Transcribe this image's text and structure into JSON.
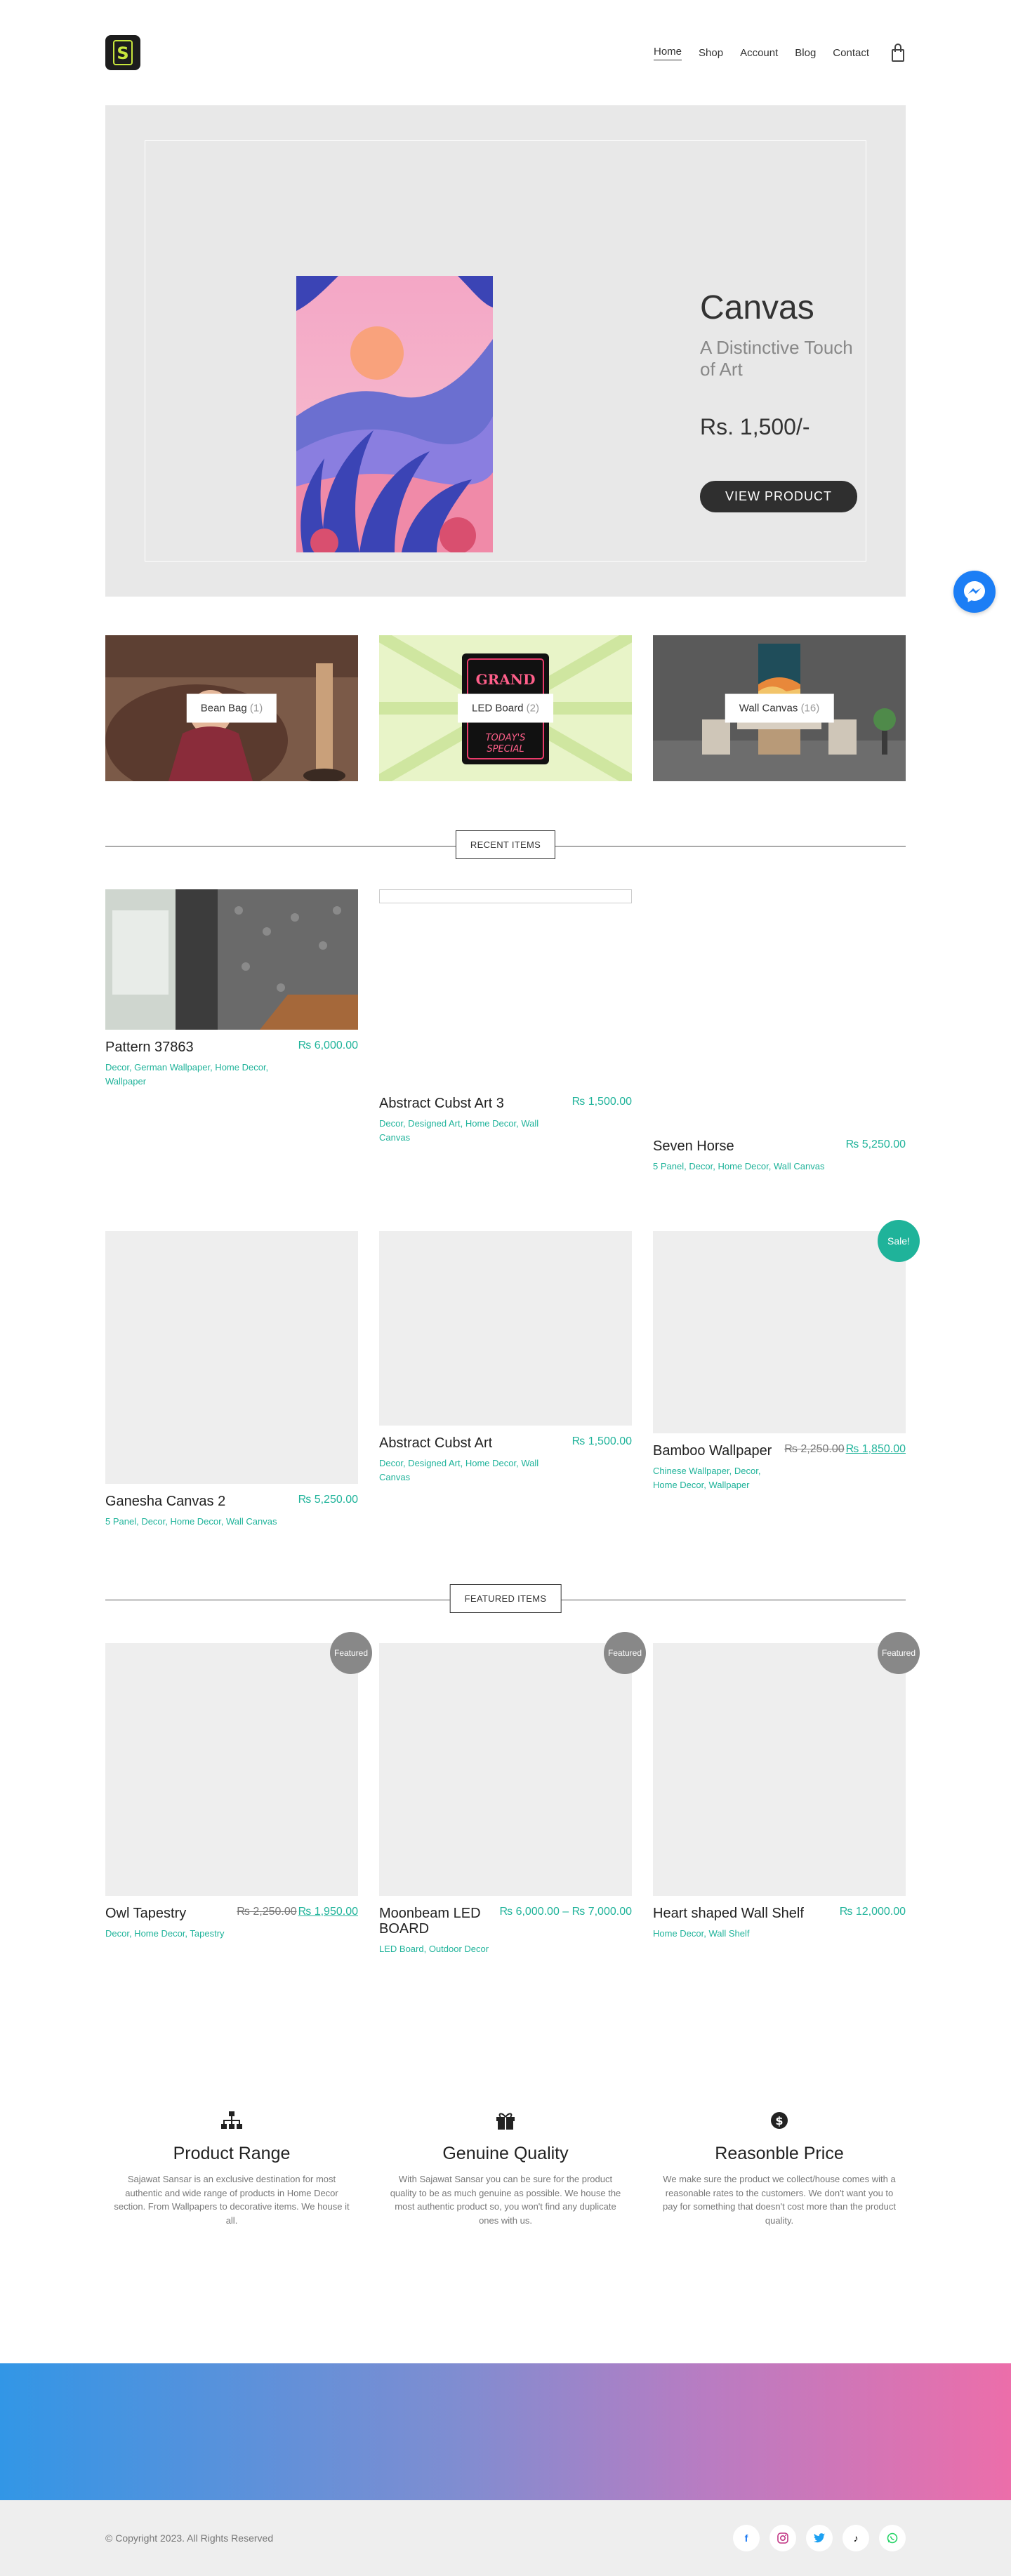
{
  "header": {
    "logo_text": "S",
    "nav": [
      {
        "label": "Home"
      },
      {
        "label": "Shop"
      },
      {
        "label": "Account"
      },
      {
        "label": "Blog"
      },
      {
        "label": "Contact"
      }
    ]
  },
  "hero": {
    "title": "Canvas",
    "subtitle": "A Distinctive Touch of Art",
    "price": "Rs. 1,500/-",
    "button": "VIEW PRODUCT"
  },
  "categories": [
    {
      "name": "Bean Bag",
      "count": "(1)"
    },
    {
      "name": "LED Board",
      "count": "(2)"
    },
    {
      "name": "Wall Canvas",
      "count": "(16)"
    }
  ],
  "led_sign": {
    "line1": "GRAND",
    "line2": "TODAY'S",
    "line3": "SPECIAL"
  },
  "recent": {
    "heading": "RECENT ITEMS",
    "items": [
      {
        "name": "Pattern 37863",
        "price": "₨ 6,000.00",
        "cats": "Decor, German Wallpaper, Home Decor, Wallpaper"
      },
      {
        "name": "Abstract Cubst Art 3",
        "price": "₨ 1,500.00",
        "cats": "Decor, Designed Art, Home Decor, Wall Canvas"
      },
      {
        "name": "Seven Horse",
        "price": "₨ 5,250.00",
        "cats": "5 Panel, Decor, Home Decor, Wall Canvas"
      },
      {
        "name": "Ganesha Canvas 2",
        "price": "₨ 5,250.00",
        "cats": "5 Panel, Decor, Home Decor, Wall Canvas"
      },
      {
        "name": "Abstract Cubst Art",
        "price": "₨ 1,500.00",
        "cats": "Decor, Designed Art, Home Decor, Wall Canvas"
      },
      {
        "name": "Bamboo Wallpaper",
        "old_price": "₨ 2,250.00",
        "price": "₨ 1,850.00",
        "cats": "Chinese Wallpaper, Decor, Home Decor, Wallpaper",
        "badge": "Sale!"
      }
    ]
  },
  "featured": {
    "heading": "FEATURED ITEMS",
    "badge": "Featured",
    "items": [
      {
        "name": "Owl Tapestry",
        "old_price": "₨ 2,250.00",
        "price": "₨ 1,950.00",
        "cats": "Decor, Home Decor, Tapestry"
      },
      {
        "name": "Moonbeam LED BOARD",
        "price": "₨ 6,000.00 – ₨ 7,000.00",
        "cats": "LED Board, Outdoor Decor"
      },
      {
        "name": "Heart shaped Wall Shelf",
        "price": "₨ 12,000.00",
        "cats": "Home Decor, Wall Shelf"
      }
    ]
  },
  "features": [
    {
      "icon": "sitemap-icon",
      "title": "Product Range",
      "text": "Sajawat Sansar is an exclusive destination for most authentic and wide range of products in Home Decor section. From Wallpapers to decorative items. We house it all."
    },
    {
      "icon": "gift-icon",
      "title": "Genuine Quality",
      "text": "With Sajawat Sansar you can be sure for the product quality to be as much genuine as possible. We house the most authentic product so, you won't find any duplicate ones with us."
    },
    {
      "icon": "dollar-icon",
      "title": "Reasonble Price",
      "text": "We make sure the product we collect/house comes with a reasonable rates to the customers. We don't want you to pay for something that doesn't cost more than the product quality."
    }
  ],
  "footer": {
    "copyright": "© Copyright 2023. All Rights Reserved",
    "socials": [
      "facebook-icon",
      "instagram-icon",
      "twitter-icon",
      "tiktok-icon",
      "whatsapp-icon"
    ]
  },
  "colors": {
    "accent": "#1fb39a",
    "dark": "#2f2f2f",
    "hero_bg": "#e8e8e8",
    "messenger": "#1c7ef5"
  }
}
